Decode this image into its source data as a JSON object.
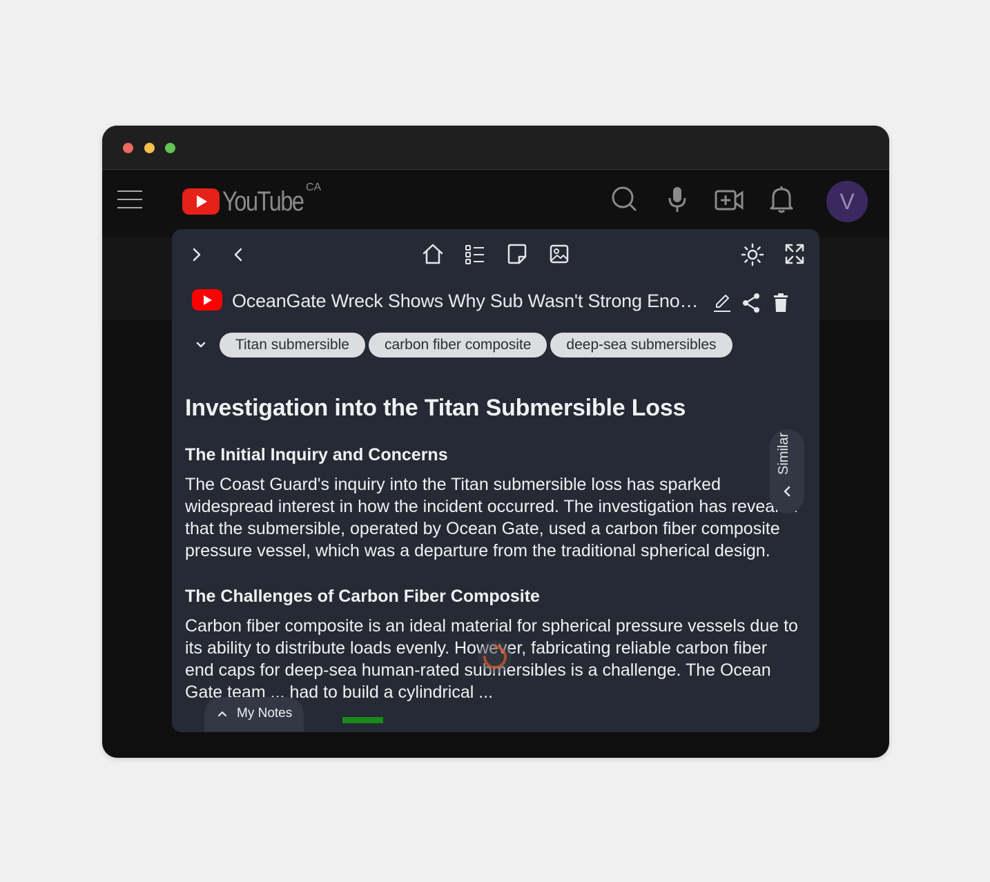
{
  "header": {
    "logo_text": "YouTube",
    "country": "CA",
    "avatar_letter": "V"
  },
  "video": {
    "title": "OceanGate Wreck Shows Why Sub Wasn't Strong Enough"
  },
  "tags": [
    "Titan submersible",
    "carbon fiber composite",
    "deep-sea submersibles"
  ],
  "article": {
    "title": "Investigation into the Titan Submersible Loss",
    "sections": [
      {
        "heading": "The Initial Inquiry and Concerns",
        "body": "The Coast Guard's inquiry into the Titan submersible loss has sparked widespread interest in how the incident occurred. The investigation has revealed that the submersible, operated by Ocean Gate, used a carbon fiber composite pressure vessel, which was a departure from the traditional spherical design."
      },
      {
        "heading": "The Challenges of Carbon Fiber Composite",
        "body": "Carbon fiber composite is an ideal material for spherical pressure vessels due to its ability to distribute loads evenly. However, fabricating reliable carbon fiber end caps for deep-sea human-rated submersibles is a challenge. The Ocean Gate team ... had to build a cylindrical ..."
      }
    ]
  },
  "similar_label": "Similar",
  "my_notes_label": "My Notes",
  "colors": {
    "panel_bg": "#252a34",
    "tag_bg": "#dcdde0",
    "youtube_red": "#ff0000",
    "avatar_bg": "#3c2860",
    "progress_green": "#1b8a1b"
  }
}
